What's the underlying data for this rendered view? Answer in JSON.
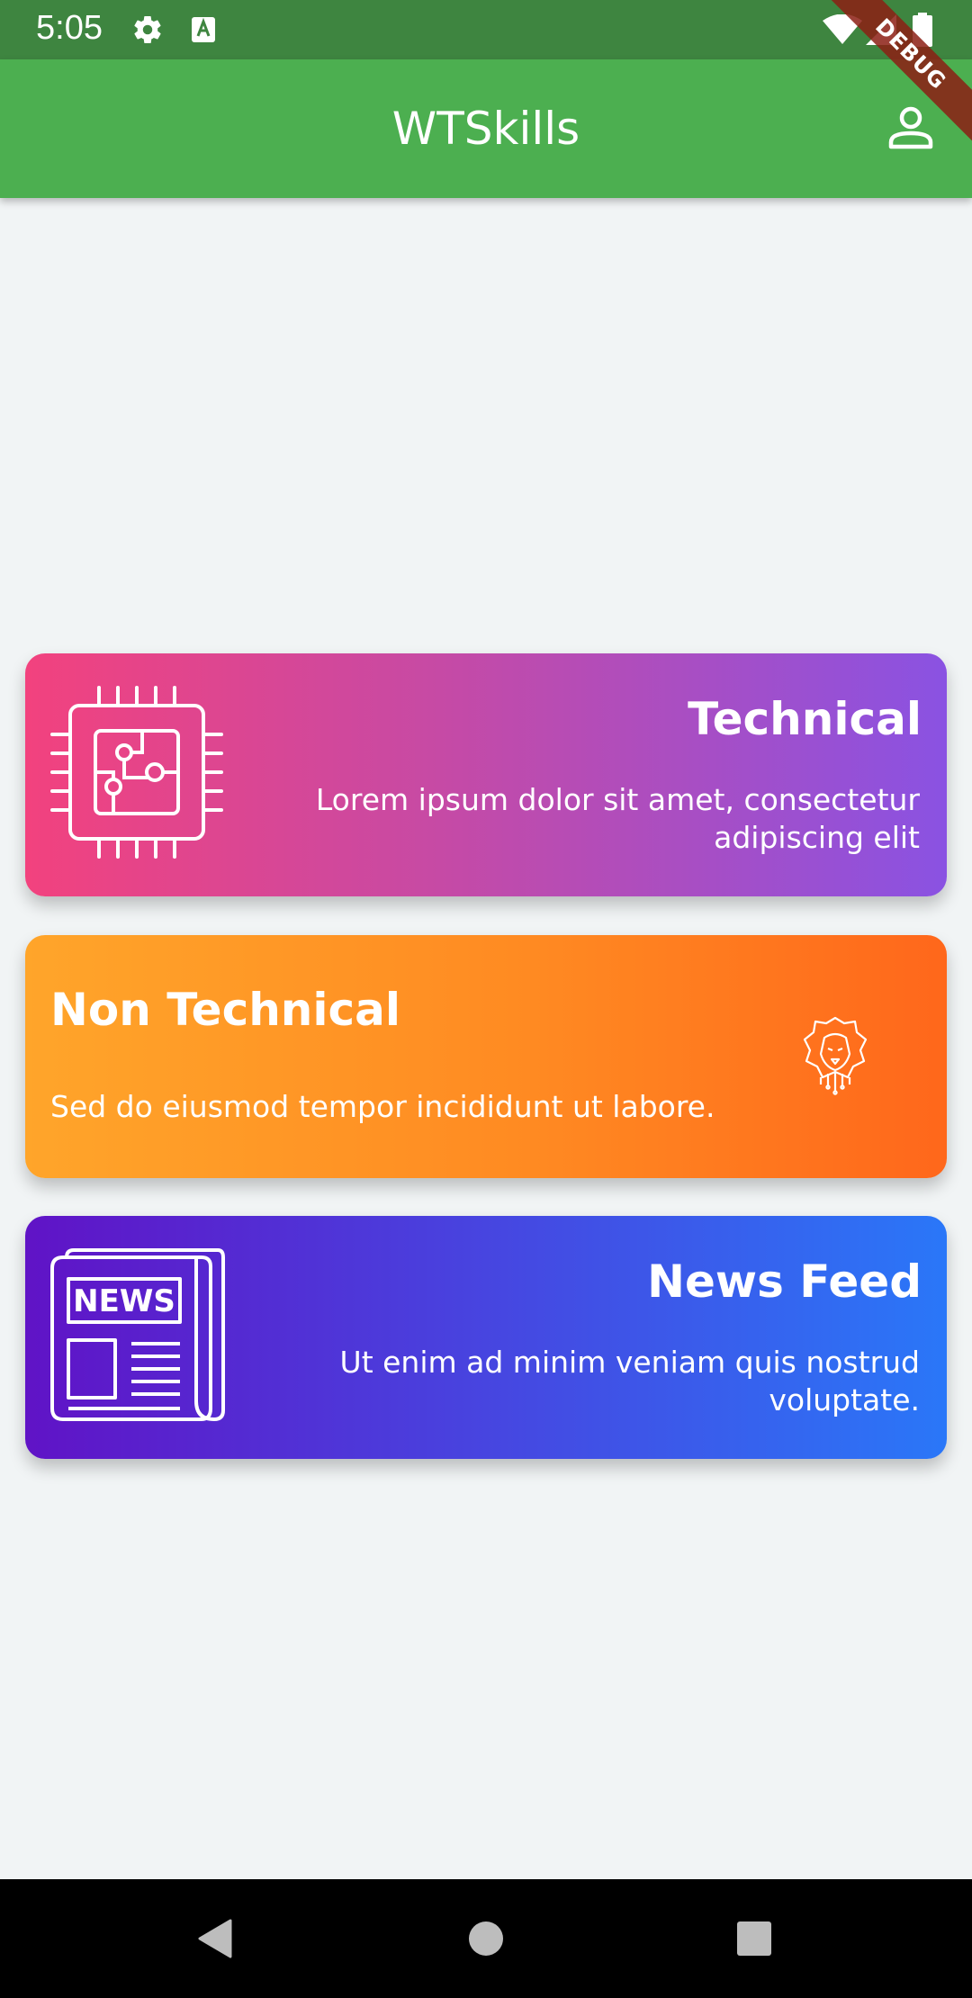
{
  "status_bar": {
    "time": "5:05"
  },
  "app_bar": {
    "title": "WTSkills",
    "debug_label": "DEBUG"
  },
  "cards": [
    {
      "title": "Technical",
      "description": "Lorem ipsum dolor sit amet, consectetur adipiscing elit",
      "icon": "chip-icon"
    },
    {
      "title": "Non Technical",
      "description": "Sed do eiusmod tempor incididunt ut labore.",
      "icon": "lion-icon"
    },
    {
      "title": "News Feed",
      "description": "Ut enim ad minim veniam quis nostrud voluptate.",
      "icon": "newspaper-icon",
      "icon_text": "NEWS"
    }
  ],
  "colors": {
    "status_bar": "#3e8540",
    "app_bar": "#4caf50",
    "background": "#f1f4f5"
  }
}
